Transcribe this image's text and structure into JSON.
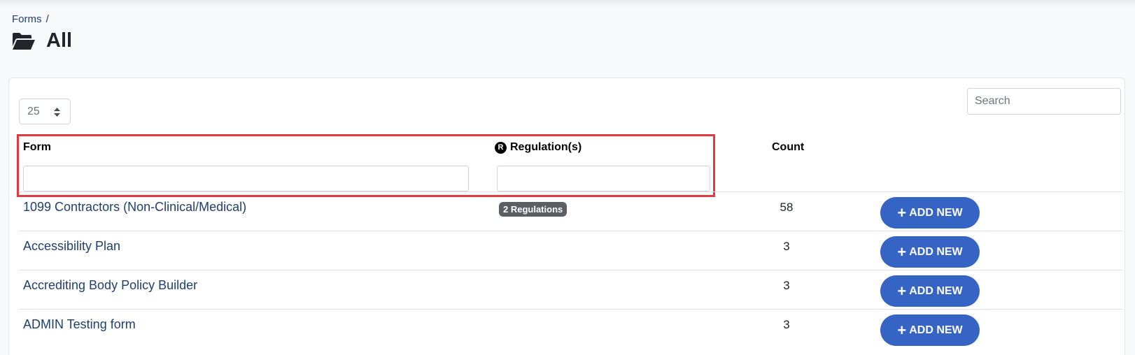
{
  "breadcrumb": {
    "parent": "Forms",
    "separator": "/"
  },
  "page": {
    "title": "All",
    "icon": "folder-open-icon"
  },
  "table": {
    "page_size": "25",
    "search_placeholder": "Search",
    "columns": {
      "form": "Form",
      "regulations": "Regulation(s)",
      "regulations_icon": "R",
      "count": "Count"
    },
    "filters": {
      "form": "",
      "regulations": ""
    },
    "rows": [
      {
        "form": "1099 Contractors (Non-Clinical/Medical)",
        "regulations": "2 Regulations",
        "count": "58",
        "action": "ADD NEW"
      },
      {
        "form": "Accessibility Plan",
        "regulations": "",
        "count": "3",
        "action": "ADD NEW"
      },
      {
        "form": "Accrediting Body Policy Builder",
        "regulations": "",
        "count": "3",
        "action": "ADD NEW"
      },
      {
        "form": "ADMIN Testing form",
        "regulations": "",
        "count": "3",
        "action": "ADD NEW"
      }
    ]
  },
  "colors": {
    "primary_button": "#3564c4",
    "link": "#1f3f6e",
    "highlight": "#e03a3e",
    "badge": "#5b5e62"
  }
}
